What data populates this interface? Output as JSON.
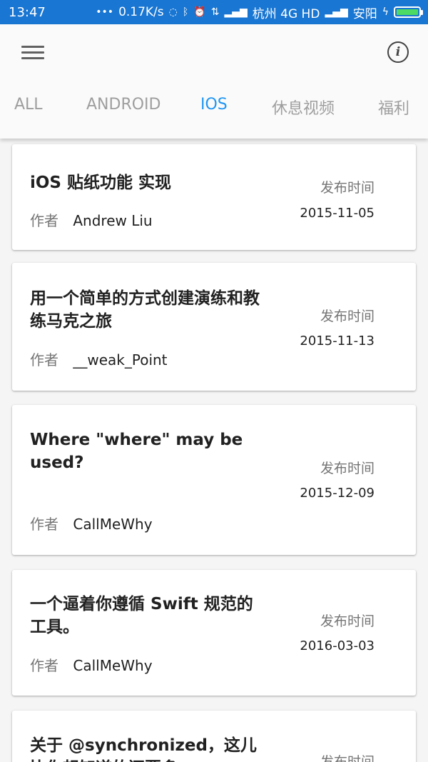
{
  "status_bar": {
    "time": "13:47",
    "net_speed": "0.17K/s",
    "icons": [
      "dots-icon",
      "sync-icon",
      "bluetooth-icon",
      "alarm-icon",
      "data-transfer-icon",
      "signal-icon",
      "signal-icon",
      "charging-icon"
    ],
    "carrier1": "杭州 4G HD",
    "carrier2": "安阳",
    "battery_level": 1.0,
    "battery_color": "#4cd964"
  },
  "app_bar": {
    "menu_icon": "hamburger-menu-icon",
    "info_icon": "info-icon",
    "info_glyph": "i"
  },
  "tabs": [
    {
      "label": "ALL",
      "active": false
    },
    {
      "label": "ANDROID",
      "active": false
    },
    {
      "label": "IOS",
      "active": true
    },
    {
      "label": "休息视频",
      "active": false
    },
    {
      "label": "福利",
      "active": false
    }
  ],
  "colors": {
    "status_bar": "#1976d2",
    "accent": "#2196f3",
    "inactive_tab": "#9e9e9e",
    "background": "#f5f5f5"
  },
  "labels": {
    "author": "作者",
    "publish_time": "发布时间"
  },
  "articles": [
    {
      "title": "iOS 贴纸功能 实现",
      "author": "Andrew Liu",
      "date": "2015-11-05"
    },
    {
      "title": "用一个简单的方式创建演练和教练马克之旅",
      "author": "__weak_Point",
      "date": "2015-11-13"
    },
    {
      "title": "Where \"where\" may be used?",
      "author": "CallMeWhy",
      "date": "2015-12-09"
    },
    {
      "title": "一个逼着你遵循 Swift 规范的工具。",
      "author": "CallMeWhy",
      "date": "2016-03-03"
    },
    {
      "title": "关于 @synchronized，这儿比你想知道的还要多",
      "author": "",
      "date": ""
    }
  ]
}
